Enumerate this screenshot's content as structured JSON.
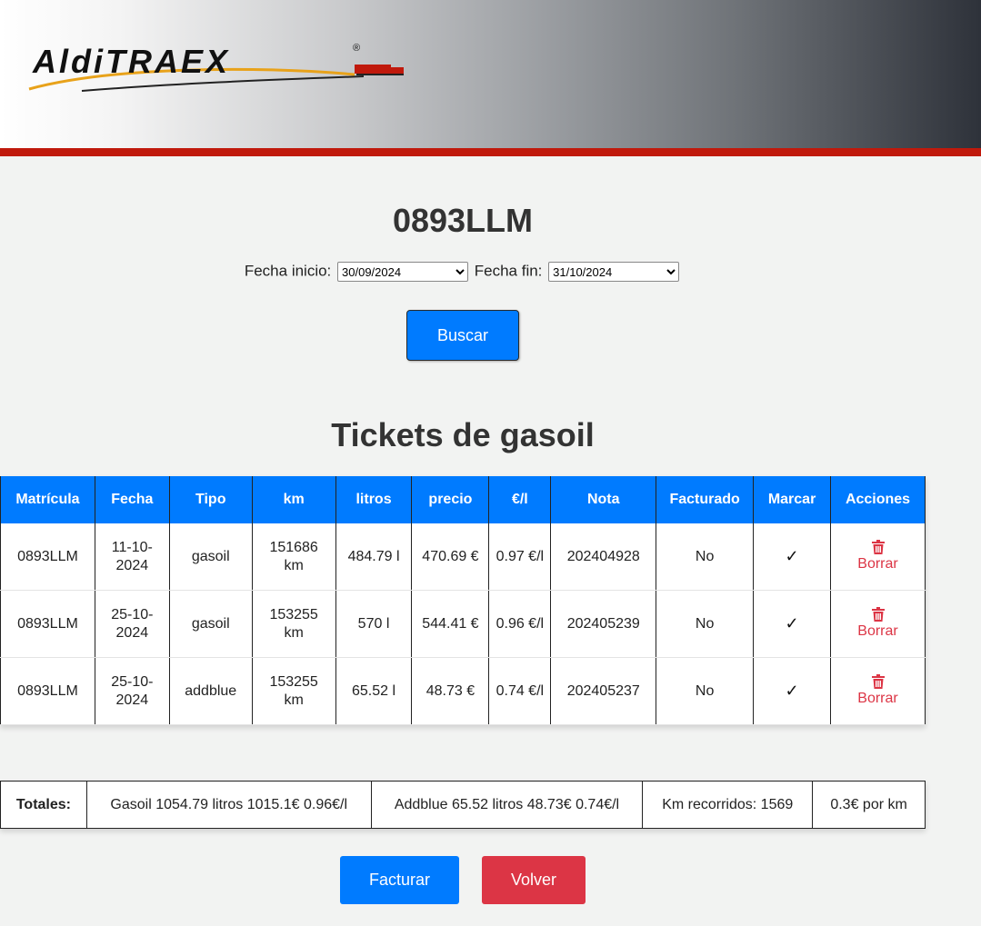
{
  "header": {
    "logo_text": "AldiTRAEX"
  },
  "vehicle": {
    "plate": "0893LLM"
  },
  "filters": {
    "start_label": "Fecha inicio:",
    "start_value": "30/09/2024",
    "end_label": "Fecha fin:",
    "end_value": "31/10/2024",
    "search_button": "Buscar"
  },
  "tickets": {
    "title": "Tickets de gasoil",
    "columns": [
      "Matrícula",
      "Fecha",
      "Tipo",
      "km",
      "litros",
      "precio",
      "€/l",
      "Nota",
      "Facturado",
      "Marcar",
      "Acciones"
    ],
    "rows": [
      {
        "matricula": "0893LLM",
        "fecha": "11-10-2024",
        "tipo": "gasoil",
        "km": "151686 km",
        "litros": "484.79 l",
        "precio": "470.69 €",
        "eur_l": "0.97 €/l",
        "nota": "202404928",
        "facturado": "No",
        "marcar": "✓",
        "accion": "Borrar"
      },
      {
        "matricula": "0893LLM",
        "fecha": "25-10-2024",
        "tipo": "gasoil",
        "km": "153255 km",
        "litros": "570 l",
        "precio": "544.41 €",
        "eur_l": "0.96 €/l",
        "nota": "202405239",
        "facturado": "No",
        "marcar": "✓",
        "accion": "Borrar"
      },
      {
        "matricula": "0893LLM",
        "fecha": "25-10-2024",
        "tipo": "addblue",
        "km": "153255 km",
        "litros": "65.52 l",
        "precio": "48.73 €",
        "eur_l": "0.74 €/l",
        "nota": "202405237",
        "facturado": "No",
        "marcar": "✓",
        "accion": "Borrar"
      }
    ]
  },
  "totals": {
    "label": "Totales:",
    "gasoil": "Gasoil 1054.79 litros 1015.1€ 0.96€/l",
    "addblue": "Addblue 65.52 litros 48.73€ 0.74€/l",
    "km": "Km recorridos: 1569",
    "per_km": "0.3€ por km"
  },
  "actions": {
    "invoice_button": "Facturar",
    "back_button": "Volver"
  },
  "colors": {
    "primary": "#007bff",
    "danger": "#dc3545",
    "header_bar": "#c0190c"
  },
  "icons": {
    "delete": "trash-icon",
    "mark": "check-icon"
  }
}
